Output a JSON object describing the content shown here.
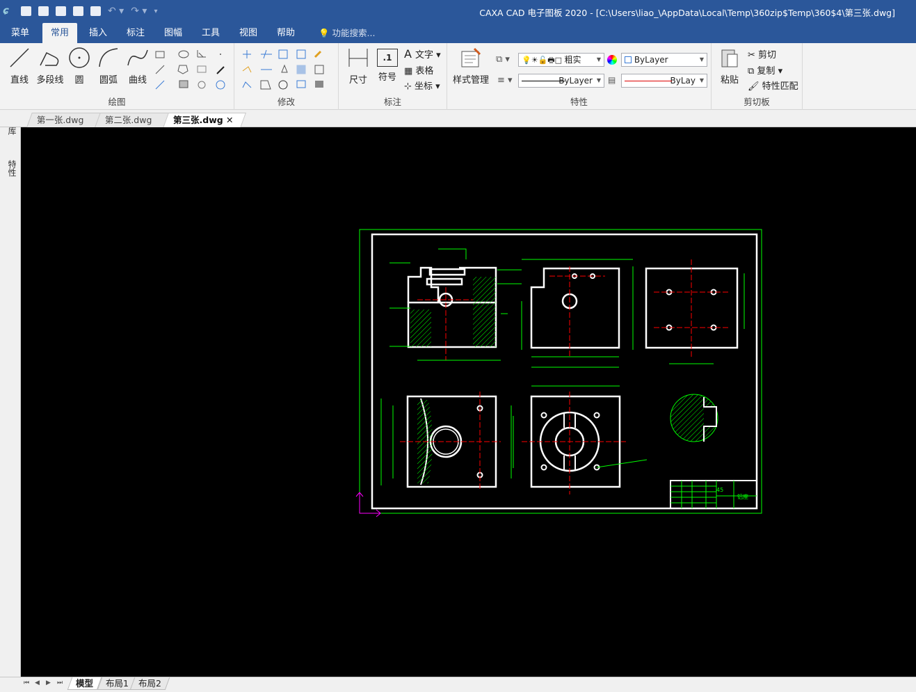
{
  "title": "CAXA CAD 电子图板 2020 - [C:\\Users\\liao_\\AppData\\Local\\Temp\\360zip$Temp\\360$4\\第三张.dwg]",
  "menu": {
    "app_menu": "菜单",
    "tabs": [
      "常用",
      "插入",
      "标注",
      "图幅",
      "工具",
      "视图",
      "帮助"
    ],
    "active_tab": "常用",
    "search_placeholder": "功能搜索..."
  },
  "ribbon": {
    "draw": {
      "group_label": "绘图",
      "buttons": [
        "直线",
        "多段线",
        "圆",
        "圆弧",
        "曲线"
      ]
    },
    "modify": {
      "group_label": "修改"
    },
    "annotate": {
      "group_label": "标注",
      "buttons": [
        "尺寸",
        "符号"
      ],
      "small": [
        "文字",
        "表格",
        "坐标"
      ],
      "symbol_text": ".1"
    },
    "properties": {
      "group_label": "特性",
      "style_button": "样式管理",
      "layer_value": "粗实",
      "color_value": "ByLayer",
      "linetype_value": "ByLayer",
      "lineweight_value": "ByLay"
    },
    "clipboard": {
      "group_label": "剪切板",
      "paste": "粘贴",
      "cut": "剪切",
      "copy": "复制",
      "match": "特性匹配"
    }
  },
  "doc_tabs": [
    "第一张.dwg",
    "第二张.dwg",
    "第三张.dwg"
  ],
  "active_doc": "第三张.dwg",
  "side_panels": [
    "图库",
    "特性"
  ],
  "layout_tabs": [
    "模型",
    "布局1",
    "布局2"
  ],
  "active_layout": "模型",
  "drawing": {
    "title_block_text": "45",
    "title_block_label": "铝座"
  },
  "colors": {
    "title_bar": "#2b579a",
    "canvas": "#000000",
    "drawing_line": "#ffffff",
    "dimension": "#00ff00",
    "centerline": "#ff0000",
    "ucs": "#ff00ff"
  }
}
